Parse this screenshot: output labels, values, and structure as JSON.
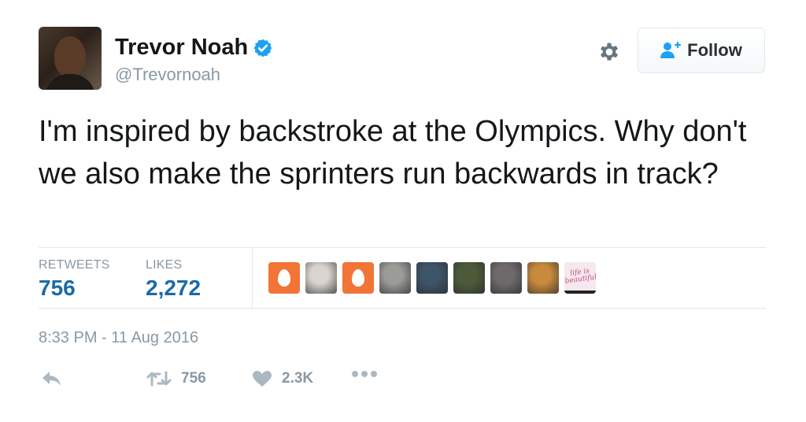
{
  "user": {
    "name": "Trevor Noah",
    "handle": "@Trevornoah"
  },
  "follow_button": {
    "label": "Follow"
  },
  "tweet": {
    "text": "I'm inspired by backstroke at the Olympics. Why don't we also make the sprinters run backwards in track?"
  },
  "stats": {
    "retweets_label": "RETWEETS",
    "retweets_value": "756",
    "likes_label": "LIKES",
    "likes_value": "2,272"
  },
  "likers": [
    {
      "kind": "egg",
      "color": "#f27436"
    },
    {
      "kind": "photo",
      "color": "#d9d4cf"
    },
    {
      "kind": "egg",
      "color": "#f27436"
    },
    {
      "kind": "photo",
      "color": "#9b9b98"
    },
    {
      "kind": "photo",
      "color": "#3e5468"
    },
    {
      "kind": "photo",
      "color": "#4d5a3a"
    },
    {
      "kind": "photo",
      "color": "#6e6a6c"
    },
    {
      "kind": "photo",
      "color": "#c98a3e"
    },
    {
      "kind": "text-image",
      "color": "#f3e9ee",
      "text": "life is beautiful"
    }
  ],
  "timestamp": "8:33 PM - 11 Aug 2016",
  "actions": {
    "reply_icon": "reply-icon",
    "retweet_count": "756",
    "like_count": "2.3K",
    "more_icon": "more-icon"
  },
  "colors": {
    "accent": "#1da1f2",
    "stat_value": "#1b6aa5",
    "muted": "#8899a6"
  }
}
